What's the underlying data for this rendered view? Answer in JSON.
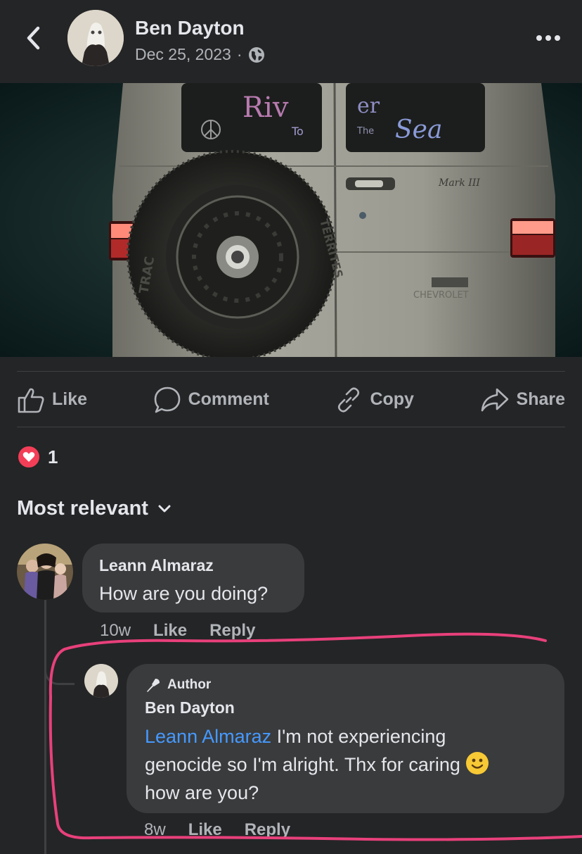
{
  "header": {
    "author": "Ben Dayton",
    "date": "Dec 25, 2023",
    "separator": "·",
    "back_icon": "chevron-left-icon",
    "privacy_icon": "globe-icon",
    "more_icon": "more-horizontal-icon"
  },
  "photo": {
    "window_text_left": "Riv",
    "window_text_left_small": "To",
    "window_text_right": "er",
    "window_text_right_small": "The",
    "window_text_right_big": "Sea",
    "badge": "Mark III",
    "brand": "CHEVROLET",
    "tire_text_left": "TRAC",
    "tire_text_right": "TERRITES"
  },
  "actions": [
    {
      "label": "Like",
      "icon": "thumbs-up-icon"
    },
    {
      "label": "Comment",
      "icon": "comment-bubble-icon"
    },
    {
      "label": "Copy",
      "icon": "link-icon"
    },
    {
      "label": "Share",
      "icon": "share-arrow-icon"
    }
  ],
  "reactions": {
    "count": "1",
    "icon": "heart-reaction-icon"
  },
  "sort": {
    "label": "Most relevant",
    "icon": "chevron-down-icon"
  },
  "comments": [
    {
      "name": "Leann Almaraz",
      "text": "How are you doing?",
      "time": "10w",
      "like": "Like",
      "reply": "Reply"
    },
    {
      "badge": "Author",
      "name": "Ben Dayton",
      "mention": "Leann Almaraz",
      "text_line1": " I'm not experiencing",
      "text_line2": "genocide so I'm alright.  Thx for caring ",
      "text_line3": "how are you?",
      "time": "8w",
      "like": "Like",
      "reply": "Reply"
    }
  ],
  "colors": {
    "background": "#242526",
    "bubble": "#3a3b3c",
    "mention": "#4599ff",
    "heart": "#f33e58",
    "highlight": "#e8407a"
  }
}
